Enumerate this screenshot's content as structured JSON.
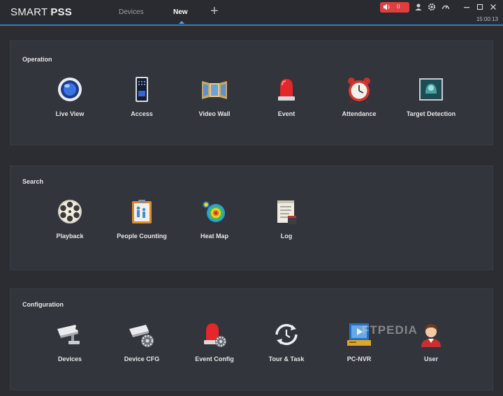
{
  "app": {
    "brand_regular": "SMART ",
    "brand_bold": "PSS"
  },
  "tabs": [
    {
      "label": "Devices",
      "active": false
    },
    {
      "label": "New",
      "active": true
    }
  ],
  "titlebar": {
    "alarm_count": "0",
    "time": "15:00:13"
  },
  "sections": [
    {
      "title": "Operation",
      "items": [
        {
          "label": "Live View",
          "icon": "camera-lens-icon"
        },
        {
          "label": "Access",
          "icon": "access-control-icon"
        },
        {
          "label": "Video Wall",
          "icon": "video-wall-icon"
        },
        {
          "label": "Event",
          "icon": "alarm-light-icon"
        },
        {
          "label": "Attendance",
          "icon": "alarm-clock-icon"
        },
        {
          "label": "Target Detection",
          "icon": "target-detection-icon"
        }
      ]
    },
    {
      "title": "Search",
      "items": [
        {
          "label": "Playback",
          "icon": "film-reel-icon"
        },
        {
          "label": "People Counting",
          "icon": "people-counting-icon"
        },
        {
          "label": "Heat Map",
          "icon": "heat-map-icon"
        },
        {
          "label": "Log",
          "icon": "log-icon"
        }
      ]
    },
    {
      "title": "Configuration",
      "items": [
        {
          "label": "Devices",
          "icon": "cctv-camera-icon"
        },
        {
          "label": "Device CFG",
          "icon": "camera-settings-icon"
        },
        {
          "label": "Event Config",
          "icon": "alarm-settings-icon"
        },
        {
          "label": "Tour & Task",
          "icon": "tour-cycle-icon"
        },
        {
          "label": "PC-NVR",
          "icon": "pc-nvr-icon"
        },
        {
          "label": "User",
          "icon": "user-icon"
        }
      ]
    }
  ],
  "watermark": "FTPEDIA",
  "colors": {
    "accent": "#2f7fc8",
    "alarm": "#e03d3d",
    "background": "#2b2d33",
    "panel": "#32353c"
  }
}
